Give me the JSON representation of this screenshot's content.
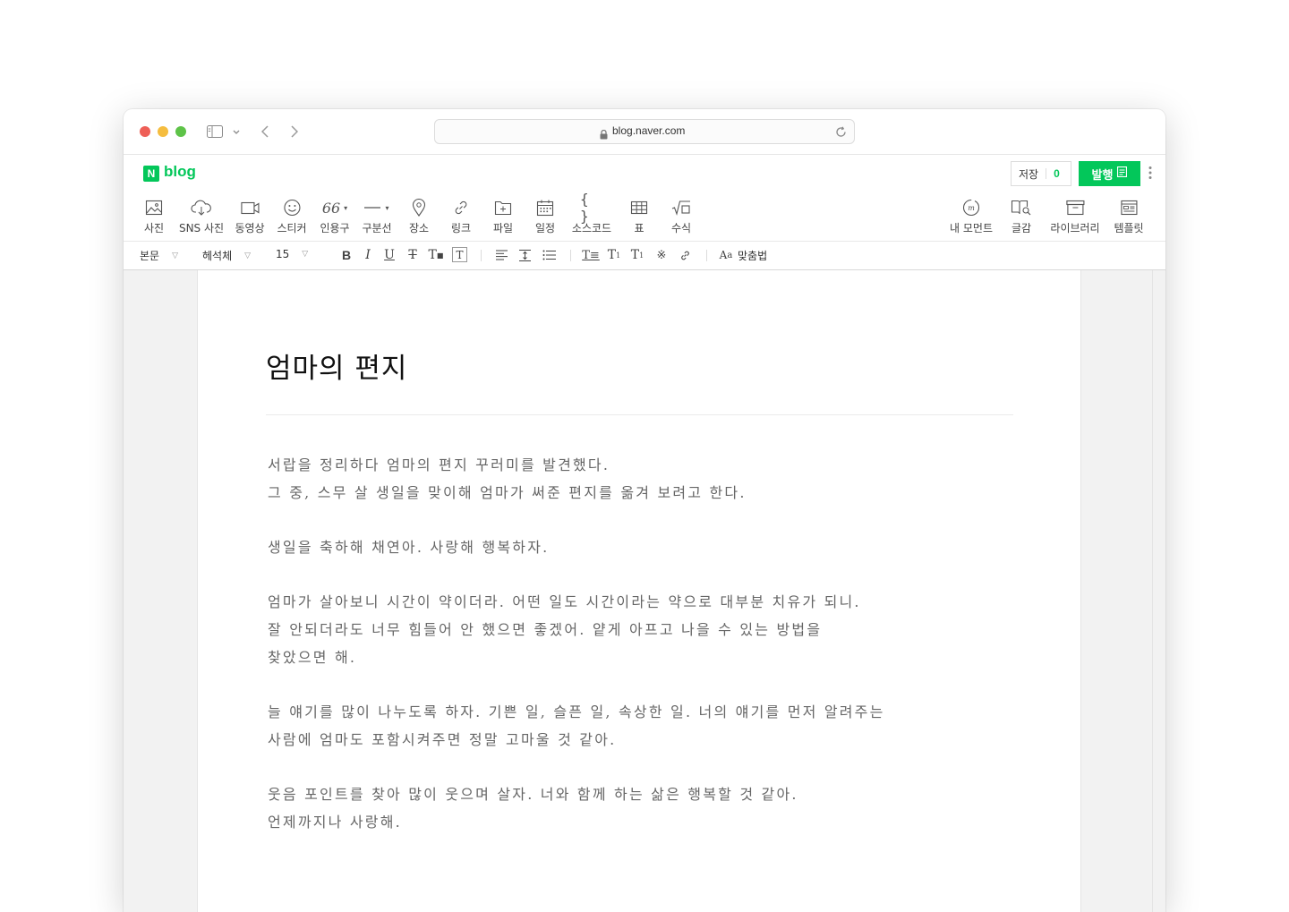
{
  "browser": {
    "url": "blog.naver.com"
  },
  "header": {
    "logo_letter": "N",
    "logo_text": "blog",
    "save_label": "저장",
    "save_count": "0",
    "publish_label": "발행"
  },
  "toolbar": {
    "items": [
      {
        "label": "사진",
        "icon": "image-icon"
      },
      {
        "label": "SNS 사진",
        "icon": "cloud-icon"
      },
      {
        "label": "동영상",
        "icon": "video-icon"
      },
      {
        "label": "스티커",
        "icon": "smile-icon"
      },
      {
        "label": "인용구",
        "icon": "quote-icon"
      },
      {
        "label": "구분선",
        "icon": "divider-icon"
      },
      {
        "label": "장소",
        "icon": "location-icon"
      },
      {
        "label": "링크",
        "icon": "link-icon"
      },
      {
        "label": "파일",
        "icon": "file-icon"
      },
      {
        "label": "일정",
        "icon": "calendar-icon"
      },
      {
        "label": "소스코드",
        "icon": "code-icon"
      },
      {
        "label": "표",
        "icon": "table-icon"
      },
      {
        "label": "수식",
        "icon": "formula-icon"
      },
      {
        "label": "내 모먼트",
        "icon": "moment-icon"
      },
      {
        "label": "글감",
        "icon": "book-search-icon"
      },
      {
        "label": "라이브러리",
        "icon": "library-icon"
      },
      {
        "label": "템플릿",
        "icon": "template-icon"
      }
    ]
  },
  "format": {
    "style": "본문",
    "font": "헤석체",
    "size": "15",
    "spellcheck_label": "맞춤법"
  },
  "document": {
    "title": "엄마의 편지",
    "paragraphs": [
      [
        "서랍을 정리하다 엄마의 편지 꾸러미를 발견했다.",
        "그 중, 스무 살 생일을 맞이해 엄마가 써준 편지를 옮겨 보려고 한다."
      ],
      [
        "생일을 축하해 채연아. 사랑해 행복하자."
      ],
      [
        "엄마가 살아보니 시간이 약이더라. 어떤 일도 시간이라는 약으로 대부분 치유가 되니.",
        "잘 안되더라도 너무 힘들어 안 했으면 좋겠어. 얕게 아프고 나을 수 있는 방법을",
        "찾았으면 해."
      ],
      [
        "늘 얘기를 많이 나누도록 하자. 기쁜 일, 슬픈 일, 속상한 일. 너의 얘기를 먼저 알려주는",
        "사람에 엄마도 포함시켜주면 정말 고마울 것 같아."
      ],
      [
        "웃음 포인트를 찾아 많이 웃으며 살자. 너와 함께 하는 삶은 행복할 것 같아.",
        "언제까지나 사랑해."
      ]
    ]
  }
}
